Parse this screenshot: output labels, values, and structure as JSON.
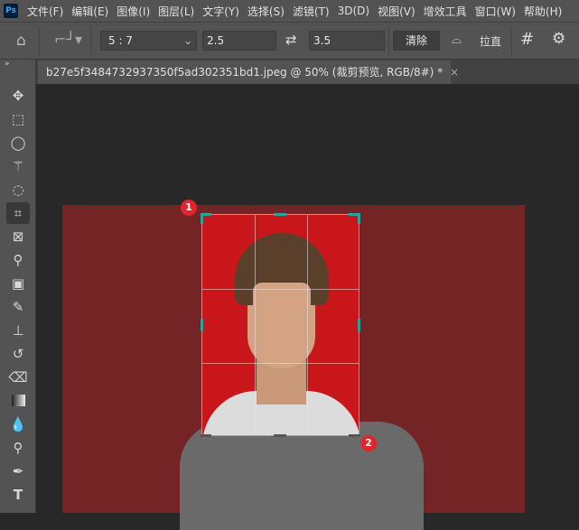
{
  "app": {
    "logo": "Ps"
  },
  "menu": [
    "文件(F)",
    "编辑(E)",
    "图像(I)",
    "图层(L)",
    "文字(Y)",
    "选择(S)",
    "滤镜(T)",
    "3D(D)",
    "视图(V)",
    "增效工具",
    "窗口(W)",
    "帮助(H)"
  ],
  "options": {
    "ratio": "5 : 7",
    "width": "2.5",
    "height": "3.5",
    "clear": "清除",
    "straighten": "拉直"
  },
  "tab": {
    "title": "b27e5f3484732937350f5ad302351bd1.jpeg @ 50% (裁剪预览, RGB/8#) *",
    "close": "×"
  },
  "markers": [
    "1",
    "2"
  ],
  "colors": {
    "background": "#c8161a",
    "canvas": "#742424",
    "handle": "#2aa39a"
  },
  "tools": [
    "move",
    "marquee",
    "lasso",
    "magic-wand",
    "quick-selection",
    "crop",
    "frame",
    "eyedropper",
    "healing",
    "brush",
    "stamp",
    "history-brush",
    "eraser",
    "gradient",
    "blur",
    "dodge",
    "pen",
    "type"
  ]
}
